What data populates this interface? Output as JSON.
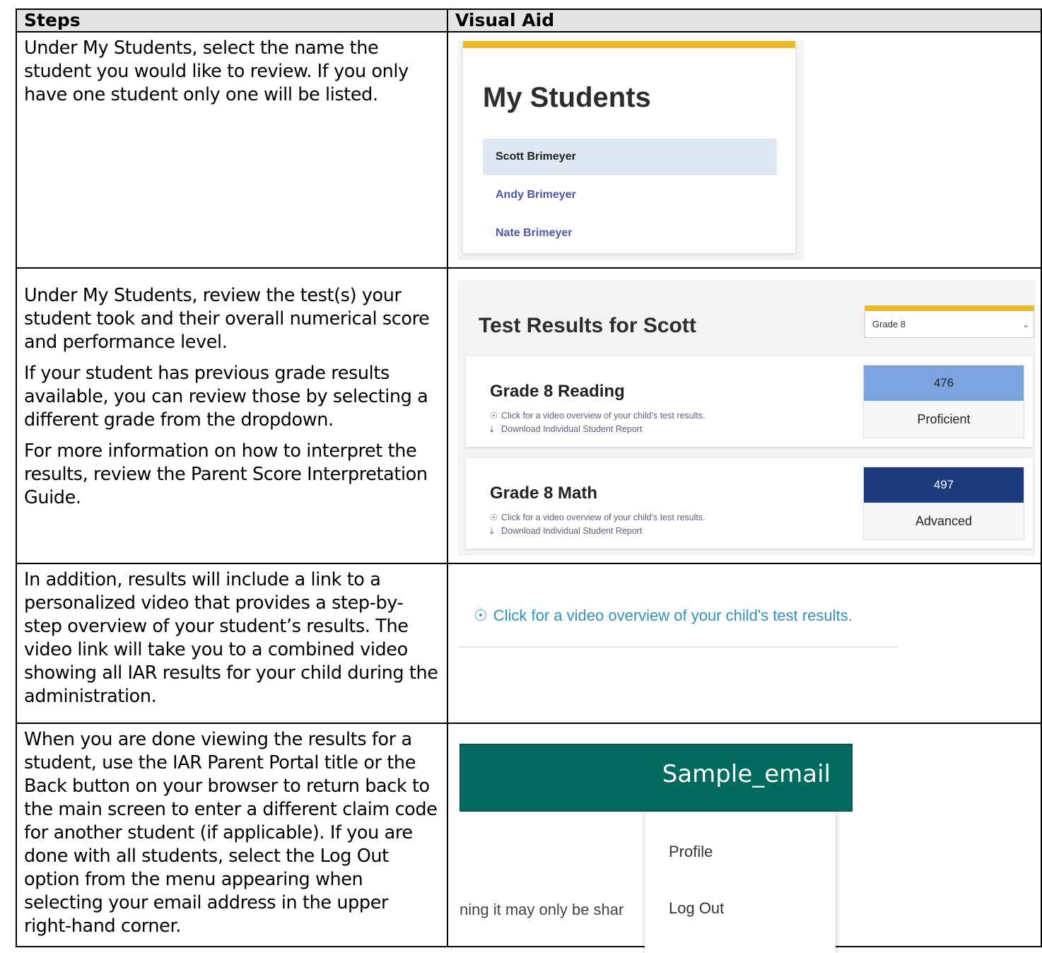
{
  "headers": {
    "steps": "Steps",
    "visual_aid": "Visual Aid"
  },
  "rows": [
    {
      "steps": [
        "Under My Students, select the name the student you would like to review.  If you only have one student only one will be listed."
      ]
    },
    {
      "steps": [
        "Under My Students, review the test(s) your student took and their overall numerical score and performance level.",
        "If your student has previous grade results available, you can review those by selecting a different grade from the dropdown.",
        "For more information on how to interpret the results, review the Parent Score Interpretation Guide."
      ]
    },
    {
      "steps": [
        "In addition, results will include a link to a personalized video that provides a step-by-step overview of your student’s results. The video link will take you to a combined video showing all IAR results for your child during the administration."
      ]
    },
    {
      "steps": [
        "When you are done viewing the results for a student, use the IAR Parent Portal title or the Back button on your browser to return back to the main screen to enter a different claim code for another student (if applicable). If you are done with all students, select the Log Out option from the menu appearing when selecting your email address in the upper right-hand corner."
      ]
    }
  ],
  "my_students": {
    "title": "My Students",
    "items": [
      {
        "name": "Scott Brimeyer",
        "selected": true
      },
      {
        "name": "Andy Brimeyer",
        "selected": false
      },
      {
        "name": "Nate Brimeyer",
        "selected": false
      }
    ],
    "accent_color": "#e9b92c"
  },
  "test_results": {
    "title": "Test Results for Scott",
    "grade_select": "Grade 8",
    "tests": [
      {
        "name": "Grade 8 Reading",
        "video_link": "Click for a video overview of your child's test results.",
        "download_link": "Download Individual Student Report",
        "score": "476",
        "level": "Proficient",
        "score_color": "#7ba3e0",
        "score_text_color": "#222222"
      },
      {
        "name": "Grade 8 Math",
        "video_link": "Click for a video overview of your child's test results.",
        "download_link": "Download Individual Student Report",
        "score": "497",
        "level": "Advanced",
        "score_color": "#1d3c7d",
        "score_text_color": "#ffffff"
      }
    ]
  },
  "video_aid": {
    "link": "Click for a video overview of your child's test results."
  },
  "email_menu": {
    "email": "Sample_email",
    "items": [
      "Profile",
      "Log Out"
    ],
    "background_text": "ning it may only be shar",
    "bar_color": "#036a5f"
  }
}
